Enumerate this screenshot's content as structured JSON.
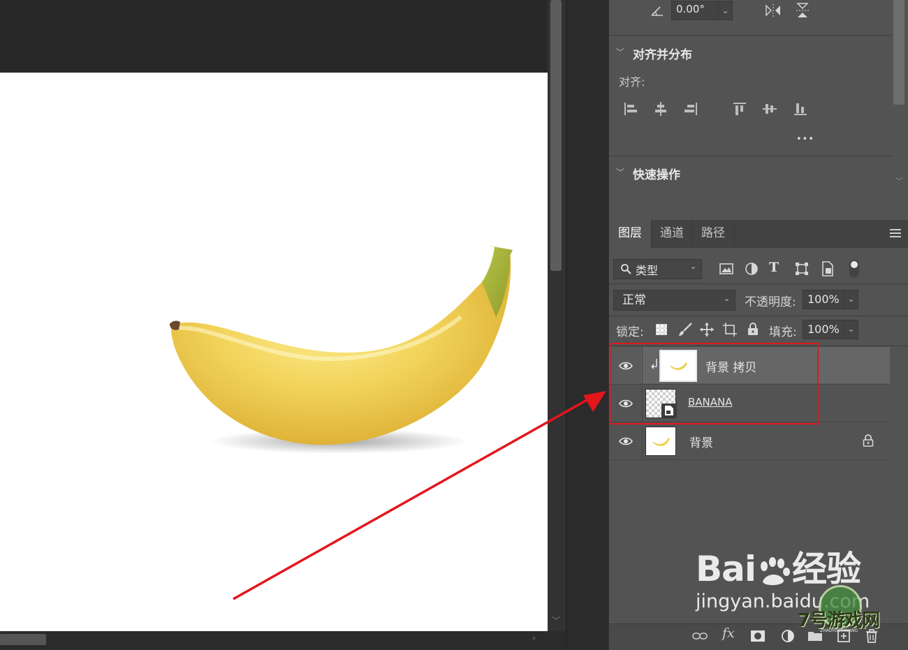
{
  "properties": {
    "angle_value": "0.00°",
    "align_section_title": "对齐并分布",
    "align_label": "对齐:",
    "more_label": "•••",
    "quick_actions_title": "快速操作"
  },
  "layers_panel": {
    "tabs": [
      {
        "label": "图层",
        "active": true
      },
      {
        "label": "通道",
        "active": false
      },
      {
        "label": "路径",
        "active": false
      }
    ],
    "filter_kind": "类型",
    "blend_mode": "正常",
    "opacity_label": "不透明度:",
    "opacity_value": "100%",
    "lock_label": "锁定:",
    "fill_label": "填充:",
    "fill_value": "100%",
    "layers": [
      {
        "name": "背景 拷贝",
        "clipped": true,
        "selected": true
      },
      {
        "name": "BANANA",
        "smart_object": true
      },
      {
        "name": "背景",
        "locked": true
      }
    ]
  },
  "watermark": {
    "brand": "Bai",
    "brand_tail": "经验",
    "url": "jingyan.baidu.com",
    "site": "7号游戏网",
    "site_sub": "ZHAOYOUXIWANG"
  },
  "colors": {
    "annotation_red": "#e3161c",
    "panel_bg": "#535353",
    "banana_yellow": "#f2d35a"
  }
}
